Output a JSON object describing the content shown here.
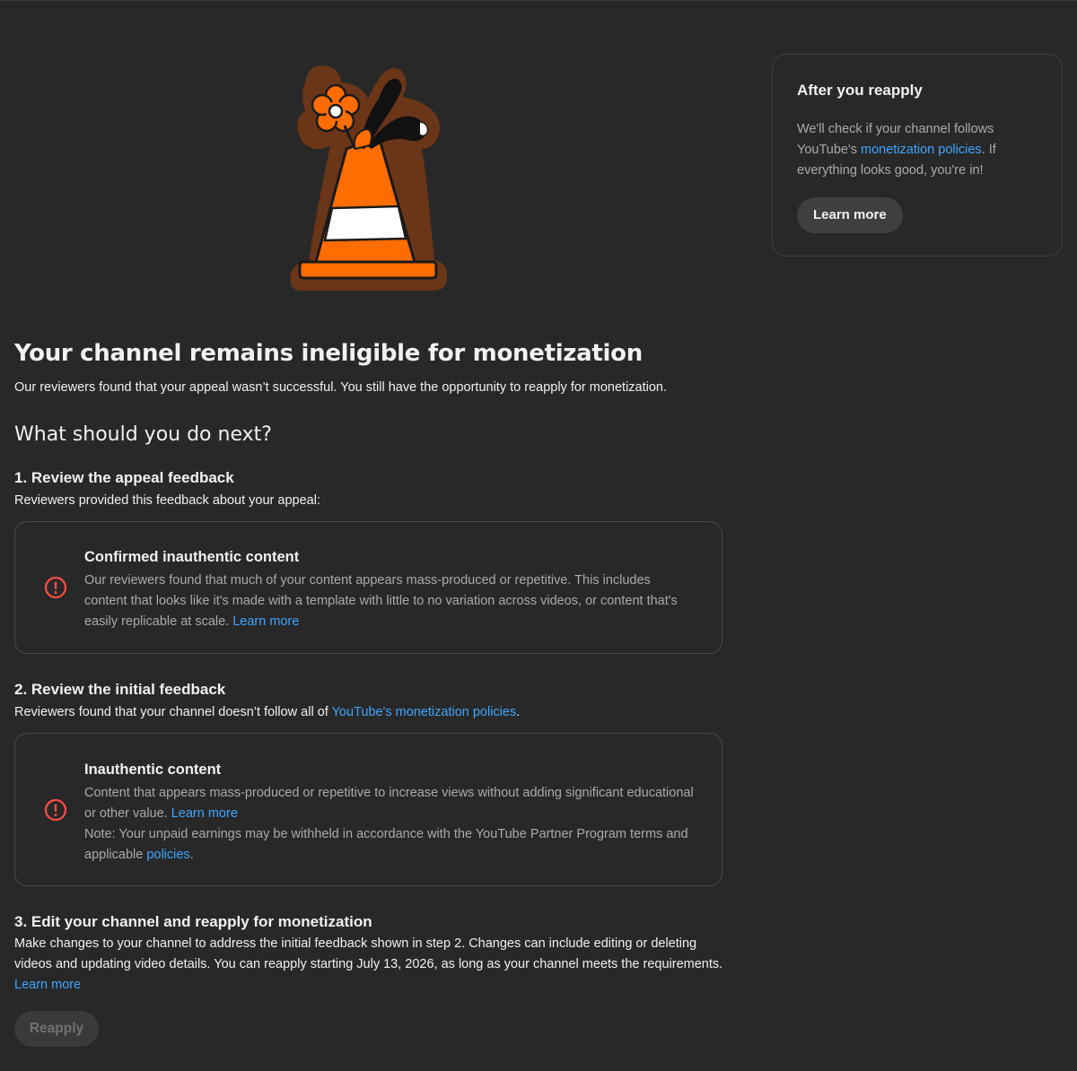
{
  "aside": {
    "title": "After you reapply",
    "text_before": "We'll check if your channel follows YouTube's ",
    "link": "monetization policies",
    "text_after": ". If everything looks good, you're in!",
    "button": "Learn more"
  },
  "main": {
    "title": "Your channel remains ineligible for monetization",
    "intro": "Our reviewers found that your appeal wasn’t successful. You still have the opportunity to reapply for monetization.",
    "next_heading": "What should you do next?"
  },
  "step1": {
    "title": "1. Review the appeal feedback",
    "subtitle": "Reviewers provided this feedback about your appeal:",
    "card": {
      "title": "Confirmed inauthentic content",
      "text": "Our reviewers found that much of your content appears mass-produced or repetitive. This includes content that looks like it's made with a template with little to no variation across videos, or content that's easily replicable at scale. ",
      "link": "Learn more",
      "icon": "alert-circle-icon"
    }
  },
  "step2": {
    "title": "2. Review the initial feedback",
    "subtitle_before": "Reviewers found that your channel doesn’t follow all of ",
    "subtitle_link": "YouTube's monetization policies",
    "subtitle_after": ".",
    "card": {
      "title": "Inauthentic content",
      "text": "Content that appears mass-produced or repetitive to increase views without adding significant educational or other value. ",
      "link": "Learn more",
      "note_before": "Note: Your unpaid earnings may be withheld in accordance with the YouTube Partner Program terms and applicable ",
      "note_link": "policies",
      "note_after": ".",
      "icon": "alert-circle-icon"
    }
  },
  "step3": {
    "title": "3. Edit your channel and reapply for monetization",
    "text": "Make changes to your channel to address the initial feedback shown in step 2. Changes can include editing or deleting videos and updating video details. You can reapply starting July 13, 2026, as long as your channel meets the requirements. ",
    "link": "Learn more",
    "button": "Reapply"
  },
  "colors": {
    "background": "#282828",
    "link": "#3ea6ff",
    "alert": "#ff4e45",
    "cone": "#ff6d00",
    "cone_outline": "#6b3518"
  }
}
